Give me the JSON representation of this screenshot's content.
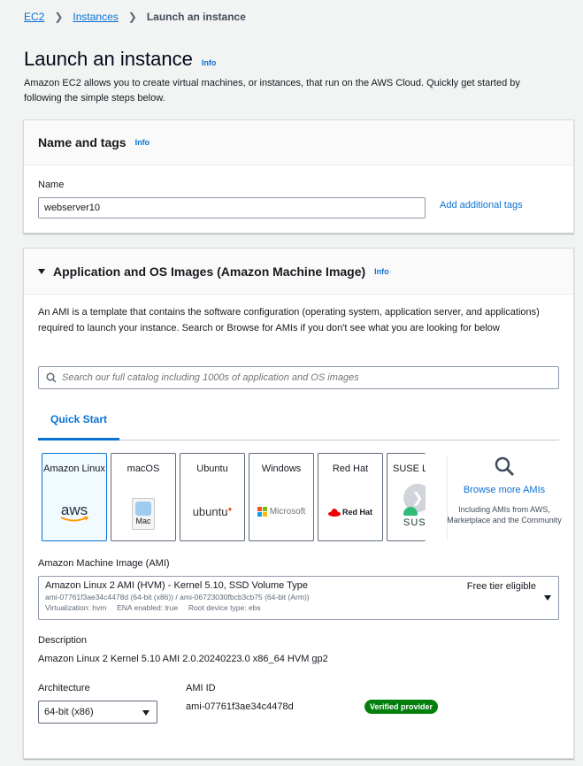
{
  "breadcrumb": {
    "items": [
      "EC2",
      "Instances"
    ],
    "current": "Launch an instance"
  },
  "page": {
    "title": "Launch an instance",
    "info": "Info",
    "description": "Amazon EC2 allows you to create virtual machines, or instances, that run on the AWS Cloud. Quickly get started by following the simple steps below."
  },
  "name_tags": {
    "title": "Name and tags",
    "info": "Info",
    "name_label": "Name",
    "name_value": "webserver10",
    "add_tags": "Add additional tags"
  },
  "ami_section": {
    "title": "Application and OS Images (Amazon Machine Image)",
    "info": "Info",
    "description": "An AMI is a template that contains the software configuration (operating system, application server, and applications) required to launch your instance. Search or Browse for AMIs if you don't see what you are looking for below",
    "search_placeholder": "Search our full catalog including 1000s of application and OS images",
    "tab": "Quick Start",
    "os_options": [
      {
        "name": "Amazon Linux",
        "logo": "aws"
      },
      {
        "name": "macOS",
        "logo": "Mac"
      },
      {
        "name": "Ubuntu",
        "logo": "ubuntu"
      },
      {
        "name": "Windows",
        "logo": "Microsoft"
      },
      {
        "name": "Red Hat",
        "logo": "Red Hat"
      },
      {
        "name": "SUSE L",
        "logo": "SUS"
      }
    ],
    "browse": {
      "link": "Browse more AMIs",
      "subtitle": "Including AMIs from AWS, Marketplace and the Community"
    },
    "ami_label": "Amazon Machine Image (AMI)",
    "ami_title": "Amazon Linux 2 AMI (HVM) - Kernel 5.10, SSD Volume Type",
    "ami_free_tier": "Free tier eligible",
    "ami_ids": "ami-07761f3ae34c4478d (64-bit (x86)) / ami-06723030fbcb3cb75 (64-bit (Arm))",
    "ami_meta": "Virtualization: hvm     ENA enabled: true     Root device type: ebs",
    "description_label": "Description",
    "description_value": "Amazon Linux 2 Kernel 5.10 AMI 2.0.20240223.0 x86_64 HVM gp2",
    "architecture_label": "Architecture",
    "architecture_value": "64-bit (x86)",
    "ami_id_label": "AMI ID",
    "ami_id_value": "ami-07761f3ae34c4478d",
    "verified": "Verified provider"
  },
  "colors": {
    "link": "#0972d3",
    "verified": "#037f0c",
    "aws_orange": "#ff9900",
    "ubuntu_orange": "#e95420",
    "redhat_red": "#ee0000"
  }
}
